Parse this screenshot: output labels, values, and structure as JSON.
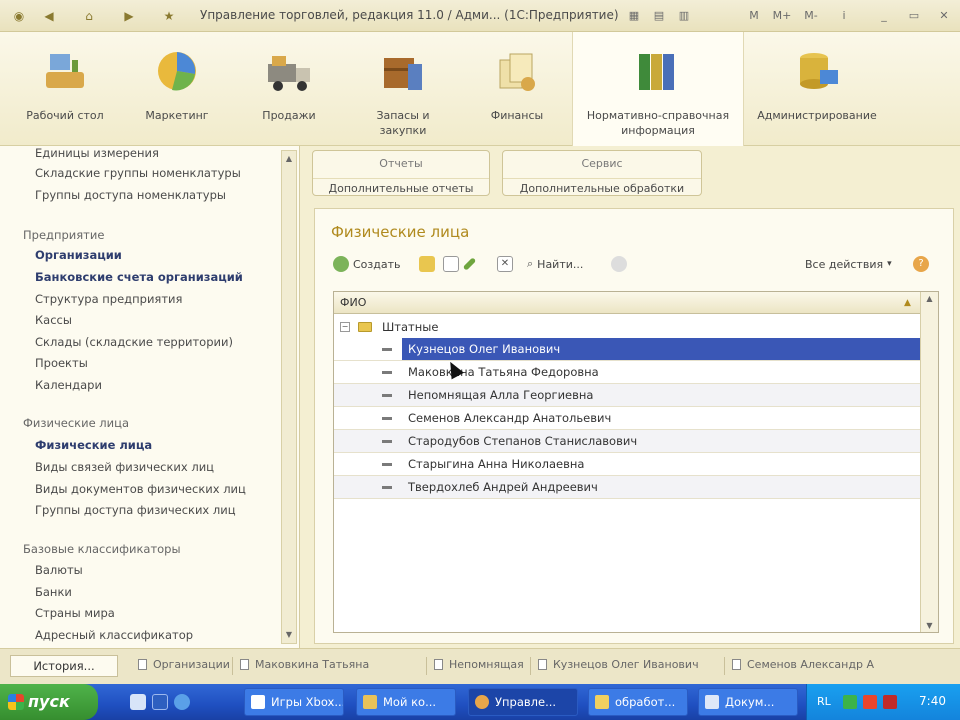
{
  "window": {
    "title": "Управление торговлей, редакция 11.0 / Адми... (1С:Предприятие)",
    "controls": [
      "M",
      "M+",
      "M-"
    ]
  },
  "sections": [
    {
      "label": "Рабочий стол",
      "icon": "desktop-icon"
    },
    {
      "label": "Маркетинг",
      "icon": "marketing-icon"
    },
    {
      "label": "Продажи",
      "icon": "sales-icon"
    },
    {
      "label": "Запасы и закупки",
      "icon": "inventory-icon"
    },
    {
      "label": "Финансы",
      "icon": "finance-icon"
    },
    {
      "label": "Нормативно-справочная информация",
      "icon": "reference-icon"
    },
    {
      "label": "Администрирование",
      "icon": "admin-icon"
    }
  ],
  "nav": {
    "top_items": [
      "Единицы измерения",
      "Складские группы номенклатуры",
      "Группы доступа номенклатуры"
    ],
    "group1": {
      "title": "Предприятие",
      "items": [
        "Организации",
        "Банковские счета организаций",
        "Структура предприятия",
        "Кассы",
        "Склады (складские территории)",
        "Проекты",
        "Календари"
      ]
    },
    "group2": {
      "title": "Физические лица",
      "items": [
        "Физические лица",
        "Виды связей физических лиц",
        "Виды документов физических лиц",
        "Группы доступа физических лиц"
      ]
    },
    "group3": {
      "title": "Базовые классификаторы",
      "items": [
        "Валюты",
        "Банки",
        "Страны мира",
        "Адресный классификатор"
      ]
    }
  },
  "commands": {
    "reports": {
      "title": "Отчеты",
      "item": "Дополнительные отчеты"
    },
    "service": {
      "title": "Сервис",
      "item": "Дополнительные обработки"
    }
  },
  "form": {
    "title": "Физические лица",
    "toolbar": {
      "create": "Создать",
      "find": "Найти...",
      "all_actions": "Все действия"
    },
    "grid": {
      "column": "ФИО",
      "group": "Штатные",
      "rows": [
        "Кузнецов Олег Иванович",
        "Маковкина Татьяна Федоровна",
        "Непомнящая Алла Георгиевна",
        "Семенов Александр Анатольевич",
        "Стародубов Степанов Станиславович",
        "Старыгина Анна Николаевна",
        "Твердохлеб Андрей Андреевич"
      ],
      "selected_index": 0
    }
  },
  "history": {
    "button": "История...",
    "items": [
      "Организации",
      "Маковкина Татьяна",
      "Непомнящая",
      "Кузнецов Олег Иванович",
      "Семенов Александр А"
    ]
  },
  "taskbar": {
    "start": "пуск",
    "tasks": [
      "Игры Xbox...",
      "Мой ко...",
      "Управле...",
      "обработ...",
      "Докум..."
    ],
    "lang": "RL",
    "time": "7:40"
  },
  "colors": {
    "accent": "#b08a1e",
    "selection": "#3a57b6",
    "taskbar": "#1f4fc0"
  }
}
